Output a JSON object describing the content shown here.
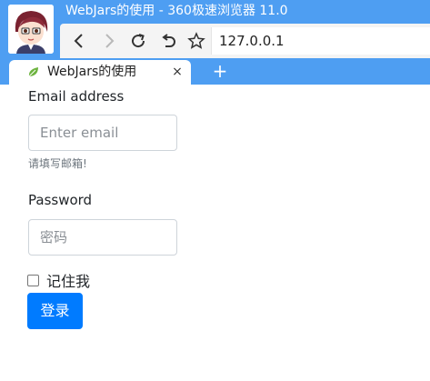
{
  "window": {
    "title": "WebJars的使用 - 360极速浏览器 11.0",
    "chrome_color": "#4e9ef2"
  },
  "toolbar": {
    "back_icon": "chevron-left-icon",
    "forward_icon": "chevron-right-icon",
    "reload_icon": "reload-icon",
    "undo_icon": "undo-icon",
    "favorite_icon": "star-icon",
    "address": "127.0.0.1"
  },
  "tab": {
    "title": "WebJars的使用",
    "close": "×",
    "new_tab": "+"
  },
  "form": {
    "email_label": "Email address",
    "email_placeholder": "Enter email",
    "email_help": "请填写邮箱!",
    "password_label": "Password",
    "password_placeholder": "密码",
    "remember_label": "记住我",
    "remember_checked": false,
    "submit_label": "登录",
    "submit_color": "#007bff"
  }
}
